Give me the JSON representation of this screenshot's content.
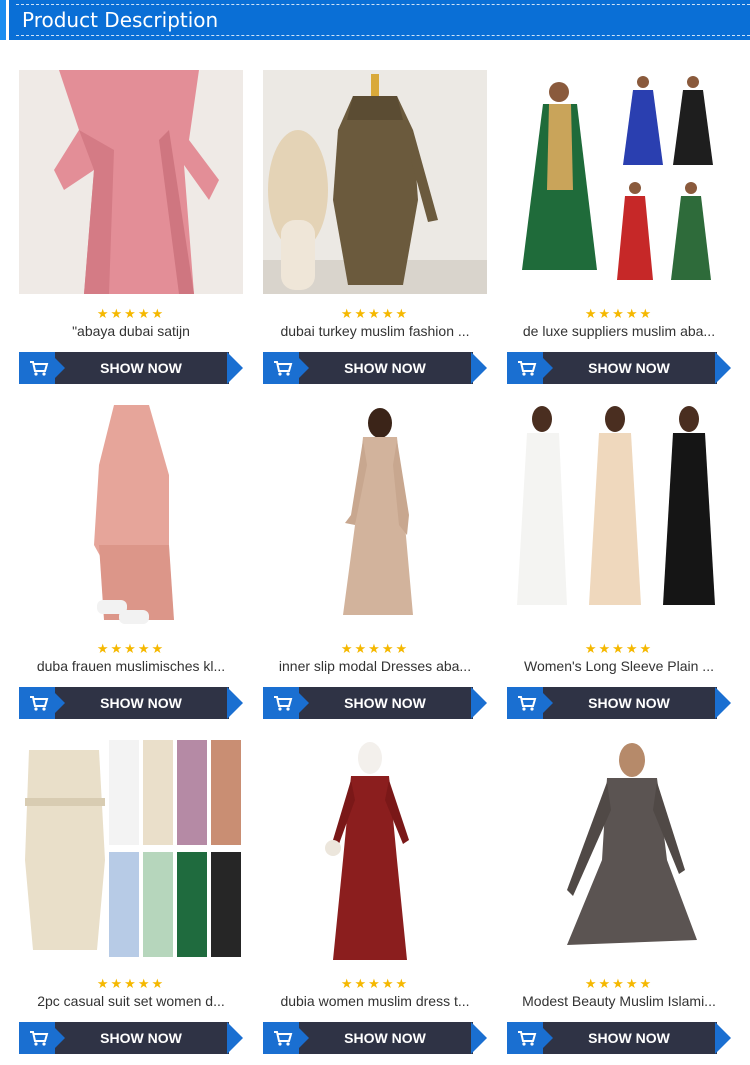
{
  "header": {
    "title": "Product Description"
  },
  "colors": {
    "header_blue": "#0a6fd6",
    "button_navy": "#2f3345",
    "button_blue": "#1a6fd1",
    "star": "#f5b800"
  },
  "icons": {
    "rating": "star-icon",
    "cart": "cart-icon"
  },
  "products": [
    {
      "name": "\"abaya dubai satijn",
      "rating": 5,
      "button": "SHOW NOW"
    },
    {
      "name": "dubai turkey muslim fashion ...",
      "rating": 5,
      "button": "SHOW NOW"
    },
    {
      "name": "de luxe suppliers muslim aba...",
      "rating": 5,
      "button": "SHOW NOW"
    },
    {
      "name": "duba frauen muslimisches kl...",
      "rating": 5,
      "button": "SHOW NOW"
    },
    {
      "name": "inner slip modal Dresses aba...",
      "rating": 5,
      "button": "SHOW NOW"
    },
    {
      "name": "Women's Long Sleeve Plain ...",
      "rating": 5,
      "button": "SHOW NOW"
    },
    {
      "name": "2pc casual suit set women d...",
      "rating": 5,
      "button": "SHOW NOW"
    },
    {
      "name": "dubia women muslim dress t...",
      "rating": 5,
      "button": "SHOW NOW"
    },
    {
      "name": "Modest Beauty Muslim Islami...",
      "rating": 5,
      "button": "SHOW NOW"
    }
  ]
}
